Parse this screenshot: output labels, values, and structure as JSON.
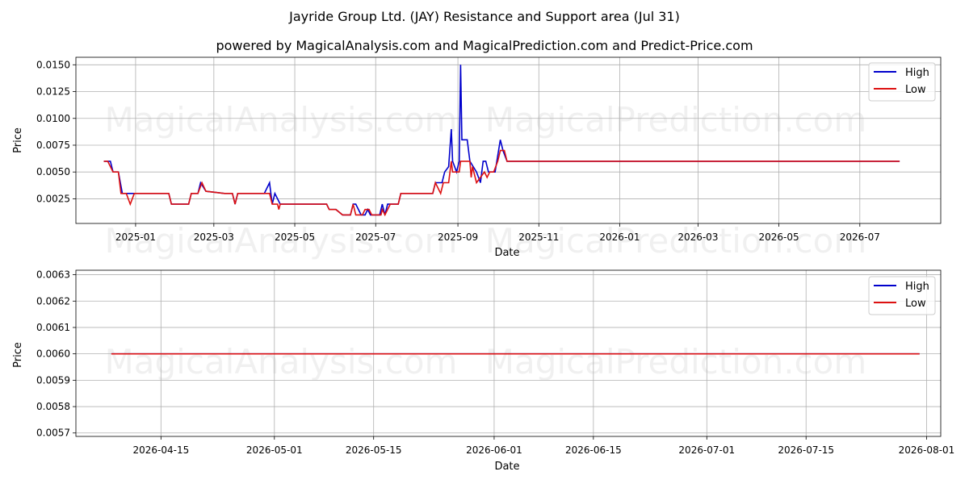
{
  "title": "Jayride Group Ltd. (JAY) Resistance and Support area (Jul 31)",
  "subtitle": "powered by MagicalAnalysis.com and MagicalPrediction.com and Predict-Price.com",
  "watermarks": [
    "MagicalAnalysis.com",
    "MagicalPrediction.com"
  ],
  "colors": {
    "high": "#0000cc",
    "low": "#dd1111",
    "grid": "#b0b0b0"
  },
  "chart_data": [
    {
      "type": "line",
      "xlabel": "Date",
      "ylabel": "Price",
      "x_ticks": [
        "2025-01",
        "2025-03",
        "2025-05",
        "2025-07",
        "2025-09",
        "2025-11",
        "2026-01",
        "2026-03",
        "2026-05",
        "2026-07"
      ],
      "y_ticks": [
        "0.0025",
        "0.0050",
        "0.0075",
        "0.0100",
        "0.0125",
        "0.0150"
      ],
      "xlim": [
        "2024-11-17",
        "2026-08-31"
      ],
      "ylim": [
        0.0002,
        0.0157
      ],
      "grid": true,
      "legend": "top-right",
      "series": [
        {
          "name": "High",
          "points": [
            [
              "2024-12-08",
              0.006
            ],
            [
              "2024-12-13",
              0.006
            ],
            [
              "2024-12-15",
              0.005
            ],
            [
              "2024-12-19",
              0.005
            ],
            [
              "2024-12-22",
              0.003
            ],
            [
              "2024-12-29",
              0.003
            ],
            [
              "2025-01-26",
              0.003
            ],
            [
              "2025-01-28",
              0.002
            ],
            [
              "2025-02-05",
              0.002
            ],
            [
              "2025-02-10",
              0.002
            ],
            [
              "2025-02-12",
              0.003
            ],
            [
              "2025-02-17",
              0.003
            ],
            [
              "2025-02-19",
              0.004
            ],
            [
              "2025-02-23",
              0.0032
            ],
            [
              "2025-03-09",
              0.003
            ],
            [
              "2025-03-15",
              0.003
            ],
            [
              "2025-03-17",
              0.002
            ],
            [
              "2025-03-19",
              0.003
            ],
            [
              "2025-04-08",
              0.003
            ],
            [
              "2025-04-12",
              0.004
            ],
            [
              "2025-04-14",
              0.002
            ],
            [
              "2025-04-16",
              0.003
            ],
            [
              "2025-04-20",
              0.002
            ],
            [
              "2025-05-25",
              0.002
            ],
            [
              "2025-05-27",
              0.0015
            ],
            [
              "2025-06-01",
              0.0015
            ],
            [
              "2025-06-06",
              0.001
            ],
            [
              "2025-06-12",
              0.001
            ],
            [
              "2025-06-14",
              0.002
            ],
            [
              "2025-06-16",
              0.002
            ],
            [
              "2025-06-20",
              0.001
            ],
            [
              "2025-06-23",
              0.001
            ],
            [
              "2025-06-25",
              0.0015
            ],
            [
              "2025-06-27",
              0.001
            ],
            [
              "2025-07-04",
              0.001
            ],
            [
              "2025-07-06",
              0.002
            ],
            [
              "2025-07-08",
              0.001
            ],
            [
              "2025-07-10",
              0.002
            ],
            [
              "2025-07-18",
              0.002
            ],
            [
              "2025-07-20",
              0.003
            ],
            [
              "2025-08-13",
              0.003
            ],
            [
              "2025-08-15",
              0.004
            ],
            [
              "2025-08-20",
              0.004
            ],
            [
              "2025-08-22",
              0.005
            ],
            [
              "2025-08-25",
              0.0055
            ],
            [
              "2025-08-27",
              0.009
            ],
            [
              "2025-08-28",
              0.006
            ],
            [
              "2025-08-31",
              0.005
            ],
            [
              "2025-09-02",
              0.006
            ],
            [
              "2025-09-03",
              0.015
            ],
            [
              "2025-09-04",
              0.008
            ],
            [
              "2025-09-08",
              0.008
            ],
            [
              "2025-09-10",
              0.006
            ],
            [
              "2025-09-15",
              0.005
            ],
            [
              "2025-09-18",
              0.004
            ],
            [
              "2025-09-20",
              0.006
            ],
            [
              "2025-09-22",
              0.006
            ],
            [
              "2025-09-24",
              0.005
            ],
            [
              "2025-09-29",
              0.005
            ],
            [
              "2025-10-03",
              0.008
            ],
            [
              "2025-10-05",
              0.007
            ],
            [
              "2025-10-08",
              0.006
            ],
            [
              "2026-07-31",
              0.006
            ]
          ]
        },
        {
          "name": "Low",
          "points": [
            [
              "2024-12-08",
              0.006
            ],
            [
              "2024-12-11",
              0.006
            ],
            [
              "2024-12-15",
              0.005
            ],
            [
              "2024-12-19",
              0.005
            ],
            [
              "2024-12-21",
              0.003
            ],
            [
              "2024-12-25",
              0.003
            ],
            [
              "2024-12-28",
              0.002
            ],
            [
              "2024-12-31",
              0.003
            ],
            [
              "2025-01-26",
              0.003
            ],
            [
              "2025-01-28",
              0.002
            ],
            [
              "2025-02-10",
              0.002
            ],
            [
              "2025-02-12",
              0.003
            ],
            [
              "2025-02-17",
              0.003
            ],
            [
              "2025-02-20",
              0.004
            ],
            [
              "2025-02-23",
              0.0032
            ],
            [
              "2025-03-09",
              0.003
            ],
            [
              "2025-03-15",
              0.003
            ],
            [
              "2025-03-17",
              0.002
            ],
            [
              "2025-03-19",
              0.003
            ],
            [
              "2025-04-12",
              0.003
            ],
            [
              "2025-04-14",
              0.002
            ],
            [
              "2025-04-18",
              0.002
            ],
            [
              "2025-04-19",
              0.0015
            ],
            [
              "2025-04-20",
              0.002
            ],
            [
              "2025-05-25",
              0.002
            ],
            [
              "2025-05-27",
              0.0015
            ],
            [
              "2025-06-01",
              0.0015
            ],
            [
              "2025-06-06",
              0.001
            ],
            [
              "2025-06-12",
              0.001
            ],
            [
              "2025-06-14",
              0.002
            ],
            [
              "2025-06-16",
              0.001
            ],
            [
              "2025-06-21",
              0.001
            ],
            [
              "2025-06-23",
              0.0015
            ],
            [
              "2025-06-26",
              0.0015
            ],
            [
              "2025-06-28",
              0.001
            ],
            [
              "2025-07-05",
              0.001
            ],
            [
              "2025-07-06",
              0.0015
            ],
            [
              "2025-07-08",
              0.001
            ],
            [
              "2025-07-12",
              0.002
            ],
            [
              "2025-07-18",
              0.002
            ],
            [
              "2025-07-20",
              0.003
            ],
            [
              "2025-08-13",
              0.003
            ],
            [
              "2025-08-15",
              0.004
            ],
            [
              "2025-08-19",
              0.003
            ],
            [
              "2025-08-21",
              0.004
            ],
            [
              "2025-08-25",
              0.004
            ],
            [
              "2025-08-27",
              0.006
            ],
            [
              "2025-08-28",
              0.005
            ],
            [
              "2025-09-02",
              0.005
            ],
            [
              "2025-09-03",
              0.006
            ],
            [
              "2025-09-10",
              0.006
            ],
            [
              "2025-09-11",
              0.0045
            ],
            [
              "2025-09-12",
              0.0055
            ],
            [
              "2025-09-15",
              0.004
            ],
            [
              "2025-09-18",
              0.0045
            ],
            [
              "2025-09-21",
              0.005
            ],
            [
              "2025-09-23",
              0.0045
            ],
            [
              "2025-09-25",
              0.005
            ],
            [
              "2025-09-28",
              0.005
            ],
            [
              "2025-10-01",
              0.006
            ],
            [
              "2025-10-03",
              0.007
            ],
            [
              "2025-10-06",
              0.007
            ],
            [
              "2025-10-08",
              0.006
            ],
            [
              "2026-07-31",
              0.006
            ]
          ]
        }
      ]
    },
    {
      "type": "line",
      "xlabel": "Date",
      "ylabel": "Price",
      "x_ticks": [
        "2026-04-15",
        "2026-05-01",
        "2026-05-15",
        "2026-06-01",
        "2026-06-15",
        "2026-07-01",
        "2026-07-15",
        "2026-08-01"
      ],
      "y_ticks": [
        "0.0057",
        "0.0058",
        "0.0059",
        "0.0060",
        "0.0061",
        "0.0062",
        "0.0063"
      ],
      "xlim": [
        "2026-04-03",
        "2026-08-03"
      ],
      "ylim": [
        0.005687,
        0.006317
      ],
      "grid": true,
      "legend": "top-right",
      "series": [
        {
          "name": "High",
          "points": [
            [
              "2026-04-08",
              0.006
            ],
            [
              "2026-07-31",
              0.006
            ]
          ]
        },
        {
          "name": "Low",
          "points": [
            [
              "2026-04-08",
              0.006
            ],
            [
              "2026-07-31",
              0.006
            ]
          ]
        }
      ]
    }
  ]
}
